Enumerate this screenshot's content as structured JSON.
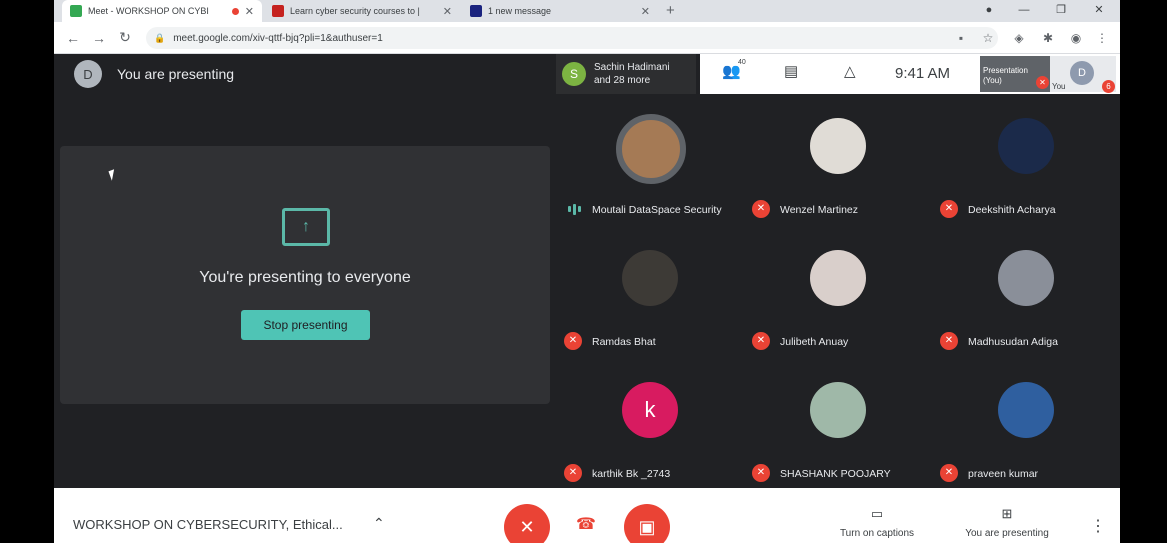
{
  "browser": {
    "tabs": [
      {
        "title": "Meet - WORKSHOP ON CYBI",
        "color": "#34a853",
        "active": true
      },
      {
        "title": "Learn cyber security courses to |",
        "color": "#c5221f",
        "active": false
      },
      {
        "title": "1 new message",
        "color": "#1a237e",
        "active": false
      }
    ],
    "close_glyph": "✕",
    "new_tab_glyph": "+",
    "address": "meet.google.com/xiv-qttf-bjq?pli=1&authuser=1"
  },
  "presenting_header": {
    "avatar_letter": "D",
    "text": "You are presenting"
  },
  "presentation_panel": {
    "message": "You're presenting to everyone",
    "stop_button": "Stop presenting"
  },
  "meeting_header": {
    "owner_initial": "S",
    "owner_line1": "Sachin Hadimani",
    "owner_line2": "and 28 more",
    "participants_badge": "40",
    "time": "9:41 AM",
    "presentation_thumb_line1": "Presentation",
    "presentation_thumb_line2": "(You)",
    "you_label": "You",
    "you_letter": "D",
    "you_count": "6"
  },
  "participants": [
    {
      "name": "Moutali DataSpace Security",
      "speaking": true,
      "avatar": "photo",
      "color": "#a57a55"
    },
    {
      "name": "Wenzel Martinez",
      "speaking": false,
      "avatar": "photo",
      "color": "#e0dcd6"
    },
    {
      "name": "Deekshith Acharya",
      "speaking": false,
      "avatar": "photo",
      "color": "#1b2a4a"
    },
    {
      "name": "Ramdas Bhat",
      "speaking": false,
      "avatar": "photo",
      "color": "#3d3a36"
    },
    {
      "name": "Julibeth Anuay",
      "speaking": false,
      "avatar": "photo",
      "color": "#d9cfcb"
    },
    {
      "name": "Madhusudan Adiga",
      "speaking": false,
      "avatar": "photo",
      "color": "#8a8f99"
    },
    {
      "name": "karthik Bk _2743",
      "speaking": false,
      "avatar": "k",
      "color": "#d81b60"
    },
    {
      "name": "SHASHANK POOJARY",
      "speaking": false,
      "avatar": "photo",
      "color": "#9fb8a8"
    },
    {
      "name": "praveen kumar",
      "speaking": false,
      "avatar": "photo",
      "color": "#2f5f9f"
    }
  ],
  "bottom_bar": {
    "meeting_title": "WORKSHOP ON CYBERSECURITY, Ethical...",
    "captions": "Turn on captions",
    "presenting": "You are presenting"
  },
  "colors": {
    "accent": "#4fc4b5",
    "mute_red": "#ea4335"
  }
}
